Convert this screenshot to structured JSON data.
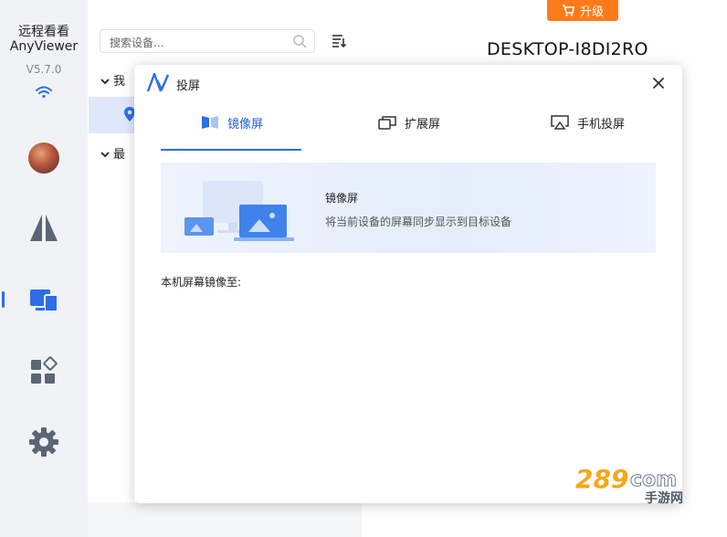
{
  "app": {
    "name_line1": "远程看看",
    "name_line2": "AnyViewer",
    "version": "V5.7.0"
  },
  "search": {
    "placeholder": "搜索设备..."
  },
  "device_list": {
    "groups": [
      {
        "label": "我"
      },
      {
        "label": "最"
      }
    ]
  },
  "header": {
    "upgrade_label": "升级",
    "device_name": "DESKTOP-I8DI2RO"
  },
  "modal": {
    "title": "投屏",
    "tabs": [
      {
        "label": "镜像屏",
        "active": true
      },
      {
        "label": "扩展屏",
        "active": false
      },
      {
        "label": "手机投屏",
        "active": false
      }
    ],
    "banner": {
      "title": "镜像屏",
      "description": "将当前设备的屏幕同步显示到目标设备"
    },
    "mirror_to_label": "本机屏幕镜像至:"
  },
  "colors": {
    "accent": "#2d6ee6",
    "upgrade": "#ff7a1a",
    "sidebar_bg": "#f0f2f5"
  },
  "icons": [
    "wifi-icon",
    "avatar",
    "remote-control-icon",
    "devices-icon",
    "apps-icon",
    "settings-icon",
    "search-icon",
    "sort-icon",
    "location-pin-icon",
    "cart-icon",
    "close-icon",
    "mirror-screen-icon",
    "extend-screen-icon",
    "phone-cast-icon"
  ],
  "watermark": {
    "text_top": "289 com",
    "text_bottom": "手游网"
  }
}
